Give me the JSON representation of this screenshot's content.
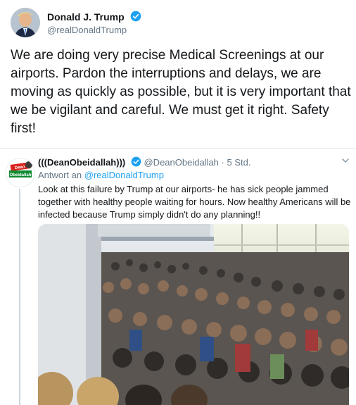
{
  "main_tweet": {
    "author_name": "Donald J. Trump",
    "author_handle": "@realDonaldTrump",
    "text": "We are doing very precise Medical Screenings at our airports. Pardon the interruptions and delays, we are moving as quickly as possible, but it is very important that we be vigilant and careful. We must get it right. Safety first!",
    "verified_color": "#1da1f2"
  },
  "reply": {
    "author_name": "(((DeanObeidallah)))",
    "author_handle": "@DeanObeidallah",
    "separator": "·",
    "time": "5 Std.",
    "replying_label": "Antwort an",
    "replying_to": "@realDonaldTrump",
    "text": "Look at this failure by Trump at our airports- he has sick people jammed together with healthy people waiting for hours. Now healthy Americans will be infected because Trump simply didn't do any planning!!",
    "avatar_text": "Dean Obeidallah"
  },
  "colors": {
    "accent": "#1da1f2",
    "secondary_text": "#657786",
    "divider": "#e6ecf0"
  }
}
